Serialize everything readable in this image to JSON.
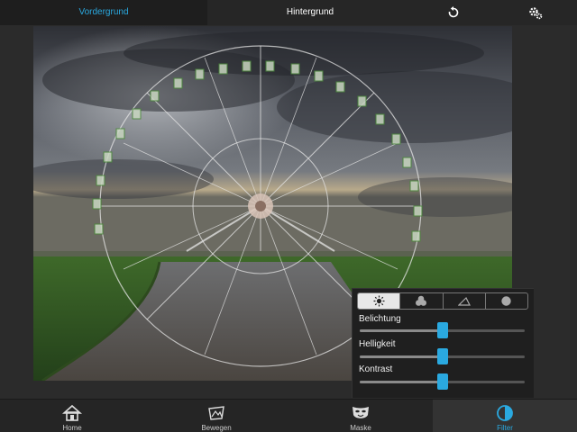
{
  "top_tabs": {
    "foreground": "Vordergrund",
    "background": "Hintergrund"
  },
  "icons": {
    "undo": "undo-icon",
    "settings": "gears-icon"
  },
  "filter_panel": {
    "modes": [
      "sun-icon",
      "color-circles-icon",
      "triangle-icon",
      "circle-icon"
    ],
    "active_mode": 0,
    "sliders": [
      {
        "label": "Belichtung",
        "value": 0.5
      },
      {
        "label": "Helligkeit",
        "value": 0.5
      },
      {
        "label": "Kontrast",
        "value": 0.5
      }
    ]
  },
  "bottom_nav": [
    {
      "label": "Home",
      "icon": "home-icon"
    },
    {
      "label": "Bewegen",
      "icon": "move-icon"
    },
    {
      "label": "Maske",
      "icon": "mask-icon"
    },
    {
      "label": "Filter",
      "icon": "filter-icon"
    }
  ],
  "active_nav": 3,
  "colors": {
    "accent": "#2aa9e0",
    "panel": "#1f1f1f",
    "bar": "#262626"
  }
}
